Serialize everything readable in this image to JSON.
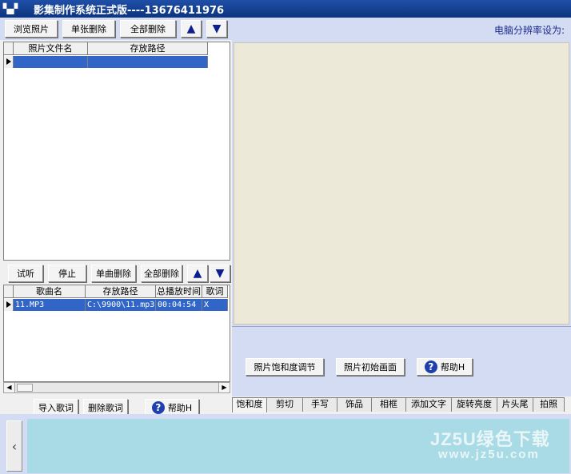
{
  "window": {
    "title": "影集制作系统正式版----13676411976",
    "icon": "film-icon"
  },
  "photo_toolbar": {
    "browse": "浏览照片",
    "delete_one": "单张删除",
    "delete_all": "全部删除"
  },
  "resolution_label": "电脑分辨率设为:",
  "photo_grid": {
    "columns": [
      "照片文件名",
      "存放路径"
    ]
  },
  "music_toolbar": {
    "play": "试听",
    "stop": "停止",
    "delete_one": "单曲删除",
    "delete_all": "全部删除"
  },
  "music_grid": {
    "columns": [
      "歌曲名",
      "存放路径",
      "总播放时间",
      "歌词"
    ],
    "rows": [
      [
        "11.MP3",
        "C:\\9900\\11.mp3",
        "00:04:54",
        "X"
      ]
    ]
  },
  "lyrics_buttons": {
    "import": "导入歌词",
    "delete": "删除歌词",
    "help": "帮助H"
  },
  "photo_actions": {
    "saturation": "照片饱和度调节",
    "initial": "照片初始画面",
    "help": "帮助H"
  },
  "tabs": [
    "饱和度",
    "剪切",
    "手写",
    "饰品",
    "相框",
    "添加文字",
    "旋转亮度",
    "片头尾",
    "拍照"
  ],
  "watermark": {
    "brand": "JZ5U绿色下载",
    "url": "www.jz5u.com"
  }
}
